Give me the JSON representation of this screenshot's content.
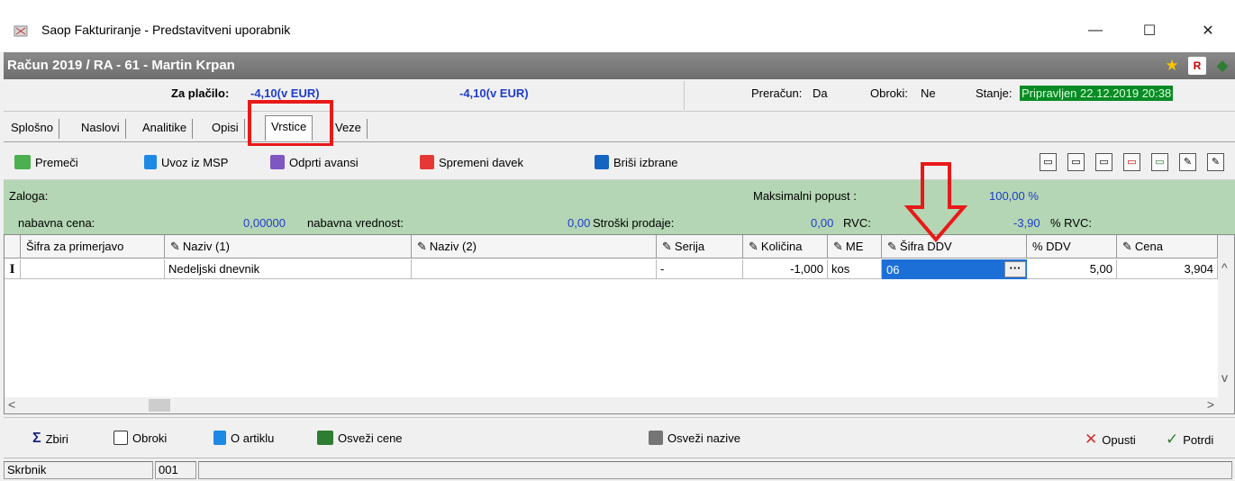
{
  "window": {
    "title": "Saop Fakturiranje - Predstavitveni uporabnik",
    "controls": {
      "minimize": "—",
      "maximize": "☐",
      "close": "✕"
    }
  },
  "document": {
    "title": "Račun  2019 / RA - 61 - Martin Krpan",
    "icons": [
      "star-icon",
      "pdf-icon",
      "book-icon"
    ]
  },
  "summary": {
    "za_placilo_label": "Za plačilo:",
    "za_placilo_value": "-4,10(v EUR)",
    "second_value": "-4,10(v EUR)",
    "preracun_label": "Preračun:",
    "preracun_value": "Da",
    "obroki_label": "Obroki:",
    "obroki_value": "Ne",
    "stanje_label": "Stanje:",
    "stanje_value": "Pripravljen 22.12.2019 20:38"
  },
  "tabs": [
    {
      "label": "Splošno"
    },
    {
      "label": "Naslovi"
    },
    {
      "label": "Analitike"
    },
    {
      "label": "Opisi"
    },
    {
      "label": "Vrstice"
    },
    {
      "label": "Veze"
    }
  ],
  "toolbar": {
    "premeci": "Premeči",
    "uvoz": "Uvoz iz MSP",
    "avansi": "Odprti avansi",
    "spremeni": "Spremeni davek",
    "brisi": "Briši izbrane"
  },
  "stock_panel": {
    "zaloga_label": "Zaloga:",
    "maks_popust_label": "Maksimalni popust :",
    "maks_popust_value": "100,00 %",
    "nabavna_cena_label": "nabavna cena:",
    "nabavna_cena_value": "0,00000",
    "nabavna_vrednost_label": "nabavna vrednost:",
    "nabavna_vrednost_value": "0,00",
    "stroski_label": "Stroški prodaje:",
    "stroski_value": "0,00",
    "rvc_label": "RVC:",
    "rvc_value": "-3,90",
    "prvc_label": "% RVC:"
  },
  "grid": {
    "columns": [
      "Šifra za primerjavo",
      "Naziv (1)",
      "Naziv (2)",
      "Serija",
      "Količina",
      "ME",
      "Šifra DDV",
      "% DDV",
      "Cena"
    ],
    "rows": [
      {
        "indicator": "I",
        "sifra": "",
        "naziv1": "Nedeljski dnevnik",
        "naziv2": "",
        "serija": "-",
        "kolicina": "-1,000",
        "me": "kos",
        "sifra_ddv": "06",
        "pct_ddv": "5,00",
        "cena": "3,904"
      }
    ]
  },
  "bottom": {
    "zbiri": "Zbiri",
    "obroki": "Obroki",
    "o_artiklu": "O artiklu",
    "osvezi_cene": "Osveži cene",
    "osvezi_nazive": "Osveži nazive",
    "opusti": "Opusti",
    "potrdi": "Potrdi"
  },
  "statusbar": {
    "label": "Skrbnik",
    "value": "001"
  },
  "colors": {
    "highlight_red": "#e81919",
    "status_green": "#0a8a26",
    "panel_green": "#b4d6b4",
    "value_blue": "#1f3dcc",
    "selection_blue": "#1d6fd8"
  }
}
